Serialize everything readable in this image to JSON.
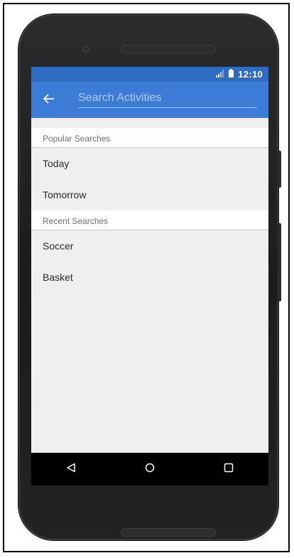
{
  "status_bar": {
    "time": "12:10",
    "icons": [
      "signal-icon",
      "battery-icon"
    ]
  },
  "app_bar": {
    "back_icon": "arrow-left-icon",
    "search_placeholder": "Search Activities",
    "search_value": ""
  },
  "sections": {
    "popular": {
      "header": "Popular Searches",
      "items": [
        "Today",
        "Tomorrow"
      ]
    },
    "recent": {
      "header": "Recent Searches",
      "items": [
        "Soccer",
        "Basket"
      ]
    }
  },
  "nav_bar": {
    "icons": [
      "back-triangle-icon",
      "home-circle-icon",
      "recents-square-icon"
    ]
  },
  "colors": {
    "status_bar": "#2f6bc2",
    "app_bar": "#3c7bd6",
    "screen_bg": "#efefef",
    "nav_bar": "#000000"
  }
}
